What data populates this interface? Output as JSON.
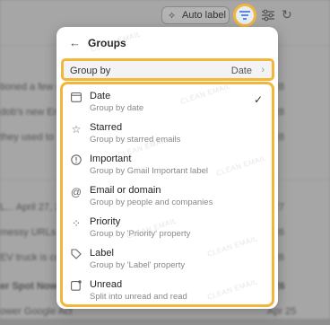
{
  "background_rows": [
    {
      "text": "tioned a few de",
      "date": "r 28"
    },
    {
      "text": "dob's new Eme",
      "date": "r 28"
    },
    {
      "text": "they used to",
      "date": "r 28"
    },
    {
      "text": "L... April 27, 20",
      "date": "r 27"
    },
    {
      "text": "messy URLs a",
      "date": "r 26"
    },
    {
      "text": "EV truck is co",
      "date": "r 26"
    },
    {
      "text": "er Spot Now! ",
      "date": "r 26"
    },
    {
      "text": "ower Google Act",
      "date": "Apr 25"
    }
  ],
  "toolbar": {
    "auto_label": "Auto label",
    "auto_label_icon": "sparkle-tag-icon",
    "filter_icon": "filter-lines-icon",
    "sliders_icon": "sliders-icon",
    "refresh_icon": "refresh-icon",
    "accent_color": "#f2b63a"
  },
  "menu": {
    "title": "Groups",
    "group_by_label": "Group by",
    "group_by_value": "Date",
    "options": [
      {
        "title": "Date",
        "subtitle": "Group by date",
        "icon": "calendar-icon",
        "selected": true
      },
      {
        "title": "Starred",
        "subtitle": "Group by starred emails",
        "icon": "star-icon",
        "selected": false
      },
      {
        "title": "Important",
        "subtitle": "Group by Gmail Important label",
        "icon": "important-icon",
        "selected": false
      },
      {
        "title": "Email or domain",
        "subtitle": "Group by people and companies",
        "icon": "at-icon",
        "selected": false
      },
      {
        "title": "Priority",
        "subtitle": "Group by 'Priority' property",
        "icon": "priority-icon",
        "selected": false
      },
      {
        "title": "Label",
        "subtitle": "Group by 'Label' property",
        "icon": "tag-icon",
        "selected": false
      },
      {
        "title": "Unread",
        "subtitle": "Split into unread and read",
        "icon": "unread-icon",
        "selected": false
      }
    ]
  },
  "watermark": "CLEAN EMAIL"
}
